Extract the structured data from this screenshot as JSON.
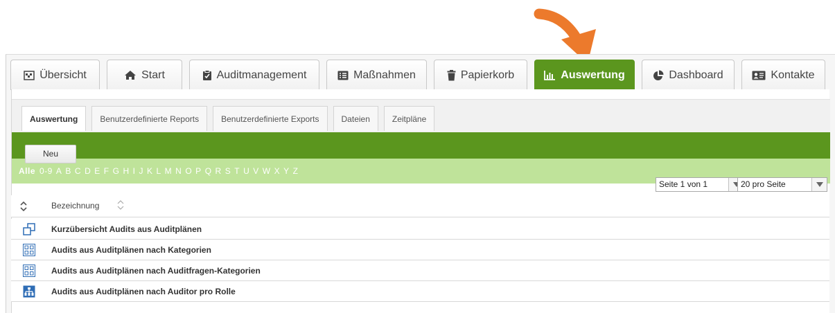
{
  "colors": {
    "accent_green": "#5b961e",
    "alpha_bar_green": "#bfe39a",
    "arrow_orange": "#ec7a2c",
    "icon_blue": "#2f6db5"
  },
  "main_tabs": [
    {
      "label": "Übersicht",
      "icon": "flag-icon"
    },
    {
      "label": "Start",
      "icon": "home-icon"
    },
    {
      "label": "Auditmanagement",
      "icon": "clipboard-icon"
    },
    {
      "label": "Maßnahmen",
      "icon": "list-icon"
    },
    {
      "label": "Papierkorb",
      "icon": "trash-icon"
    },
    {
      "label": "Auswertung",
      "icon": "bar-chart-icon",
      "active": true
    },
    {
      "label": "Dashboard",
      "icon": "pie-chart-icon"
    },
    {
      "label": "Kontakte",
      "icon": "contact-card-icon"
    }
  ],
  "sub_tabs": [
    {
      "label": "Auswertung",
      "active": true
    },
    {
      "label": "Benutzerdefinierte Reports"
    },
    {
      "label": "Benutzerdefinierte Exports"
    },
    {
      "label": "Dateien"
    },
    {
      "label": "Zeitpläne"
    }
  ],
  "toolbar": {
    "new_label": "Neu"
  },
  "alphabet": {
    "all_label": "Alle",
    "letters": [
      "0-9",
      "A",
      "B",
      "C",
      "D",
      "E",
      "F",
      "G",
      "H",
      "I",
      "J",
      "K",
      "L",
      "M",
      "N",
      "O",
      "P",
      "Q",
      "R",
      "S",
      "T",
      "U",
      "V",
      "W",
      "X",
      "Y",
      "Z"
    ]
  },
  "pagination": {
    "page_label": "Seite 1 von 1",
    "per_page_label": "20 pro Seite"
  },
  "table": {
    "column_header": "Bezeichnung",
    "rows": [
      {
        "label": "Kurzübersicht Audits aus Auditplänen",
        "icon": "overlapping-squares-icon"
      },
      {
        "label": "Audits aus Auditplänen nach Kategorien",
        "icon": "grid-icon"
      },
      {
        "label": "Audits aus Auditplänen nach Auditfragen-Kategorien",
        "icon": "grid-icon"
      },
      {
        "label": "Audits aus Auditplänen nach Auditor pro Rolle",
        "icon": "org-chart-icon"
      }
    ]
  }
}
